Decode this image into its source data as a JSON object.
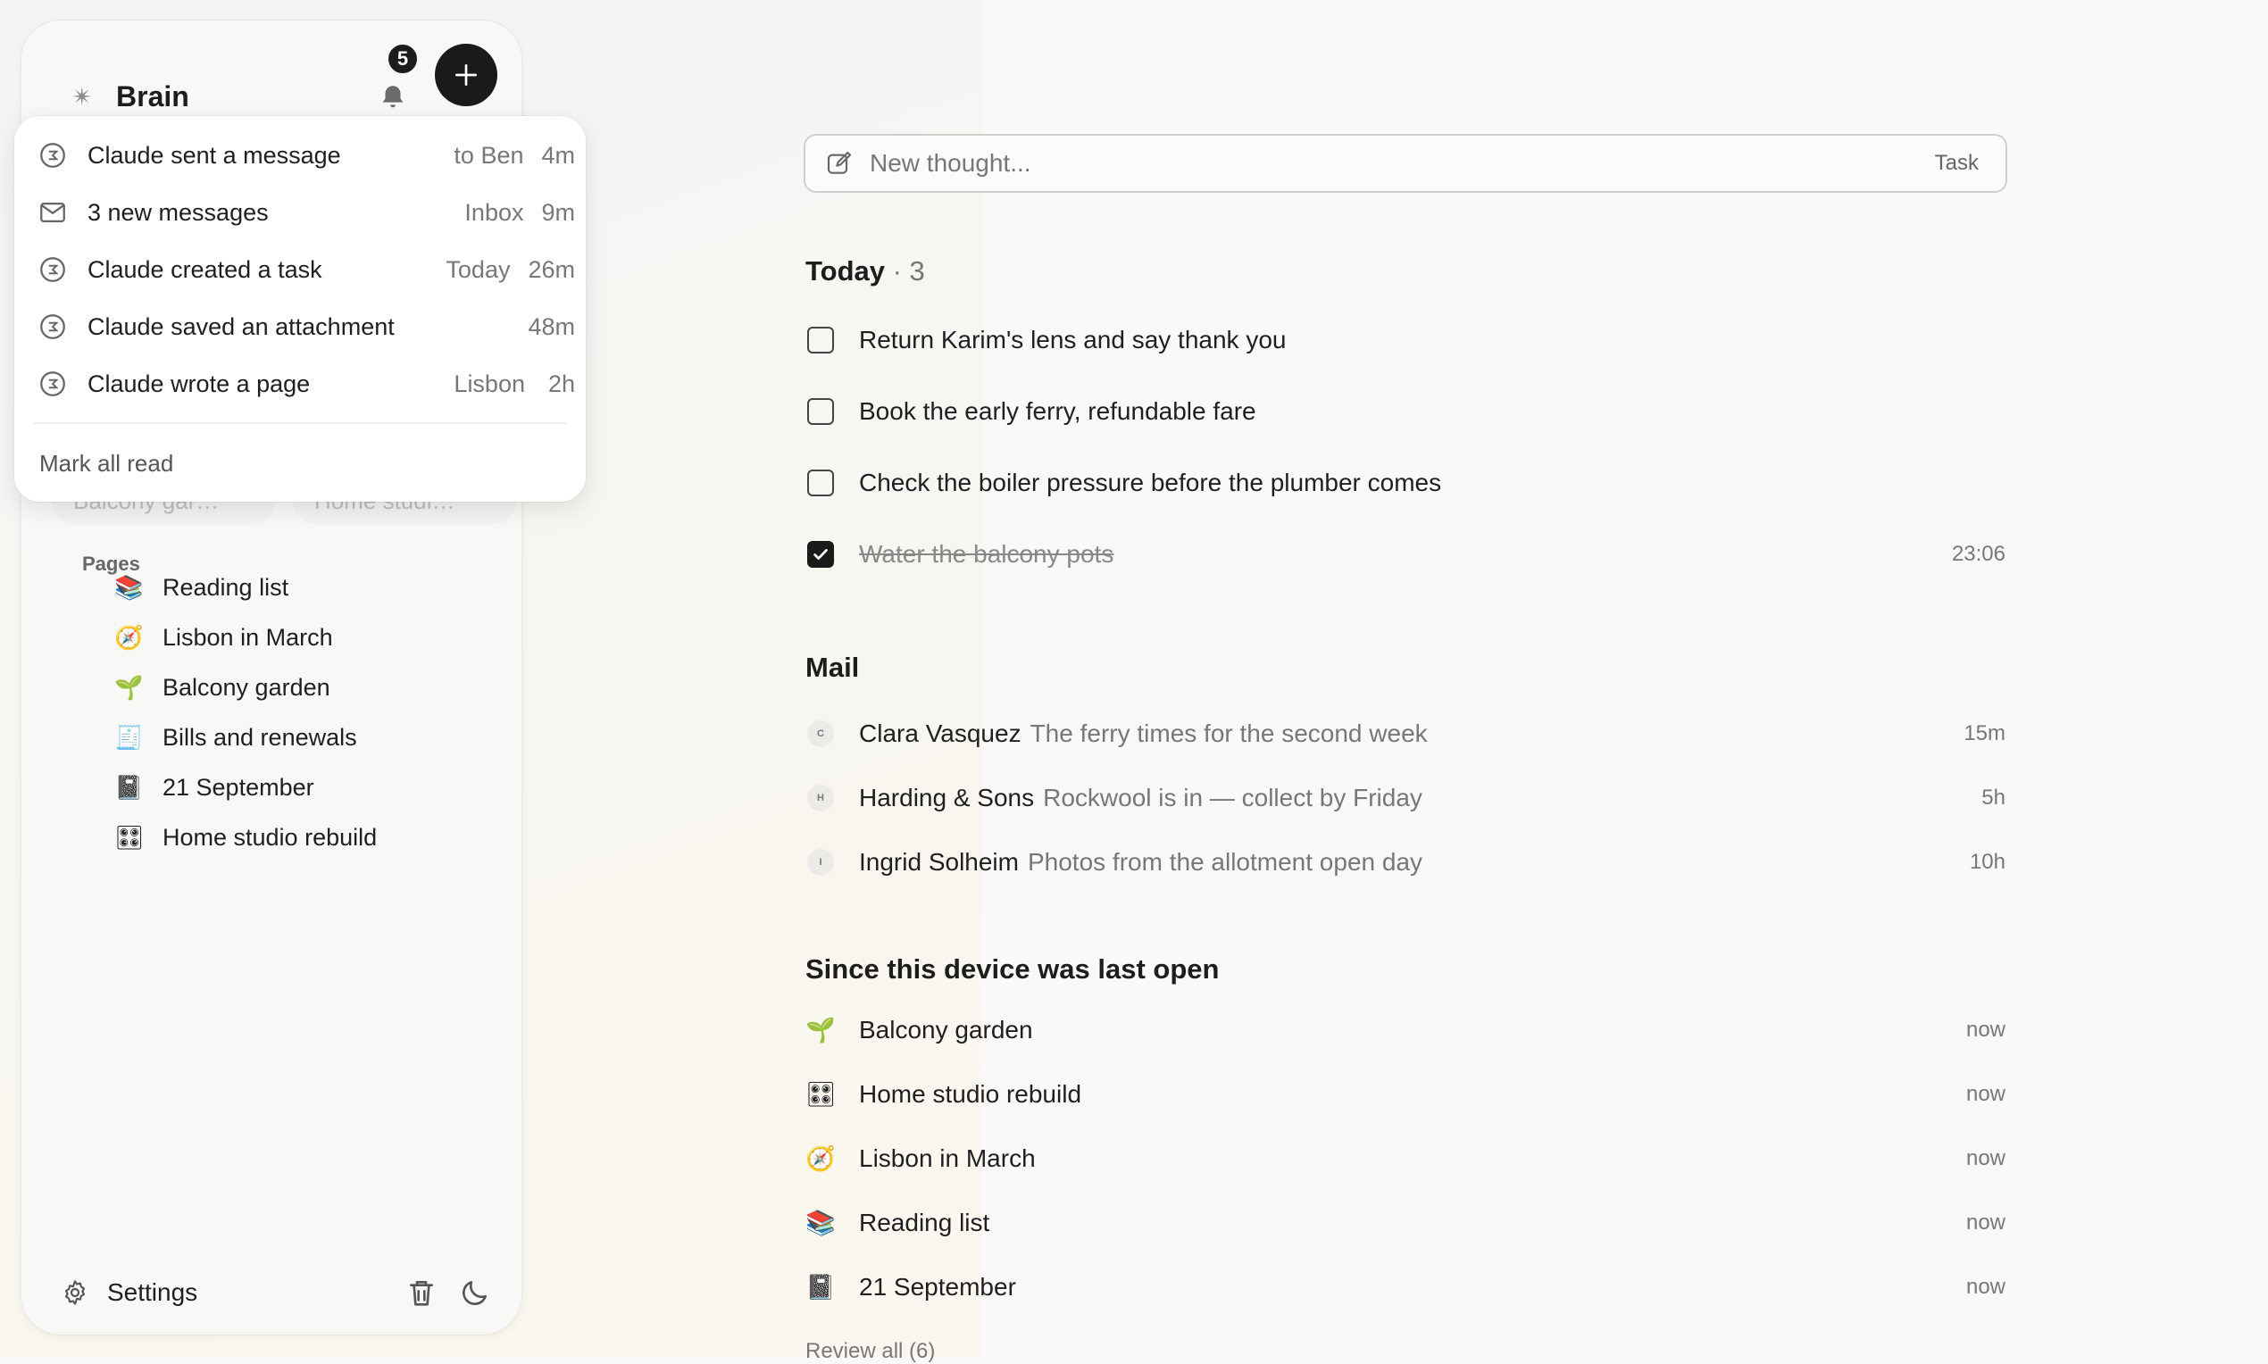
{
  "sidebar": {
    "brand": {
      "title": "Brain",
      "icon": "brain-icon"
    },
    "notifications_count": "5",
    "faded_chips": [
      "Balcony gar…",
      "Home studi…"
    ],
    "pages_label": "Pages",
    "pages": [
      {
        "icon": "📚",
        "label": "Reading list"
      },
      {
        "icon": "🧭",
        "label": "Lisbon in March"
      },
      {
        "icon": "🌱",
        "label": "Balcony garden"
      },
      {
        "icon": "🧾",
        "label": "Bills and renewals"
      },
      {
        "icon": "📓",
        "label": "21 September"
      },
      {
        "icon": "🎛",
        "label": "Home studio rebuild"
      }
    ],
    "footer": {
      "settings_label": "Settings"
    }
  },
  "notifications": {
    "items": [
      {
        "icon": "claude-icon",
        "title": "Claude sent a message",
        "context": "to Ben",
        "time": "4m"
      },
      {
        "icon": "mail-icon",
        "title": "3 new messages",
        "context": "Inbox",
        "time": "9m"
      },
      {
        "icon": "claude-icon",
        "title": "Claude created a task",
        "context": "Today",
        "time": "26m"
      },
      {
        "icon": "claude-icon",
        "title": "Claude saved an attachment",
        "context": "",
        "time": "48m"
      },
      {
        "icon": "claude-icon",
        "title": "Claude wrote a page",
        "context": "Lisbon",
        "time": "2h"
      }
    ],
    "mark_all_read": "Mark all read"
  },
  "main": {
    "thought": {
      "placeholder": "New thought...",
      "task_label": "Task"
    },
    "today": {
      "title": "Today",
      "count": "· 3",
      "tasks": [
        {
          "text": "Return Karim's lens and say thank you",
          "done": false,
          "time": ""
        },
        {
          "text": "Book the early ferry, refundable fare",
          "done": false,
          "time": ""
        },
        {
          "text": "Check the boiler pressure before the plumber comes",
          "done": false,
          "time": ""
        },
        {
          "text": "Water the balcony pots",
          "done": true,
          "time": "23:06"
        }
      ]
    },
    "mail": {
      "title": "Mail",
      "items": [
        {
          "initial": "C",
          "sender": "Clara Vasquez",
          "subject": "The ferry times for the second week",
          "time": "15m"
        },
        {
          "initial": "H",
          "sender": "Harding & Sons",
          "subject": "Rockwool is in — collect by Friday",
          "time": "5h"
        },
        {
          "initial": "I",
          "sender": "Ingrid Solheim",
          "subject": "Photos from the allotment open day",
          "time": "10h"
        }
      ]
    },
    "since": {
      "title": "Since this device was last open",
      "items": [
        {
          "icon": "🌱",
          "label": "Balcony garden",
          "time": "now"
        },
        {
          "icon": "🎛",
          "label": "Home studio rebuild",
          "time": "now"
        },
        {
          "icon": "🧭",
          "label": "Lisbon in March",
          "time": "now"
        },
        {
          "icon": "📚",
          "label": "Reading list",
          "time": "now"
        },
        {
          "icon": "📓",
          "label": "21 September",
          "time": "now"
        }
      ],
      "review_all": "Review all (6)"
    }
  }
}
